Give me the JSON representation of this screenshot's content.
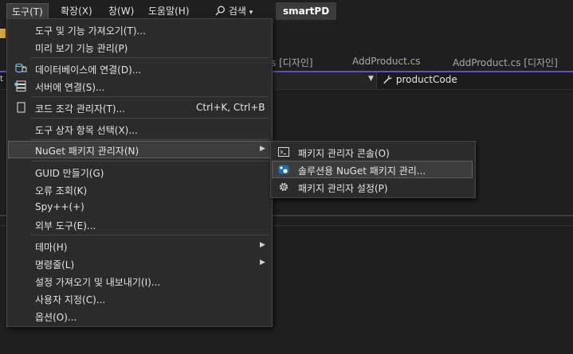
{
  "menubar": {
    "items": [
      "도구(T)",
      "확장(X)",
      "창(W)",
      "도움말(H)"
    ],
    "search_label": "검색",
    "search_chevron": "▾",
    "project_name": "smartPD"
  },
  "editor": {
    "tabs": [
      "s [디자인]",
      "AddProduct.cs",
      "AddProduct.cs [디자인]"
    ],
    "left_fragment": "t",
    "nav_member": "productCode"
  },
  "tools_menu": {
    "item_import_features": "도구 및 기능 가져오기(T)...",
    "item_preview_features": "미리 보기 기능 관리(P)",
    "item_connect_db": "데이터베이스에 연결(D)...",
    "item_connect_server": "서버에 연결(S)...",
    "item_snippet_manager": "코드 조각 관리자(T)...",
    "item_snippet_shortcut": "Ctrl+K, Ctrl+B",
    "item_toolbox_items": "도구 상자 항목 선택(X)...",
    "item_nuget": "NuGet 패키지 관리자(N)",
    "item_guid": "GUID 만들기(G)",
    "item_error_lookup": "오류 조회(K)",
    "item_spy": "Spy++(+)",
    "item_external_tools": "외부 도구(E)...",
    "item_theme": "테마(H)",
    "item_command_line": "명령줄(L)",
    "item_import_export": "설정 가져오기 및 내보내기(I)...",
    "item_customize": "사용자 지정(C)...",
    "item_options": "옵션(O)...",
    "submenu_arrow": "▶"
  },
  "nuget_submenu": {
    "item_console": "패키지 관리자 콘솔(O)",
    "item_manage_solution": "솔루션용 NuGet 패키지 관리...",
    "item_settings": "패키지 관리자 설정(P)"
  },
  "colors": {
    "accent": "#5b53b9",
    "menu_background": "#2b2b2b",
    "highlight": "#3d3d3d",
    "ide_background": "#1f1f1f"
  },
  "icons": {
    "connect_db": "database-plug-icon",
    "connect_server": "server-icon",
    "snippet_manager": "snippet-page-icon",
    "console": "console-window-icon",
    "manage_solution": "nuget-package-icon",
    "settings": "gear-icon",
    "search": "search-icon",
    "member": "wrench-icon"
  }
}
